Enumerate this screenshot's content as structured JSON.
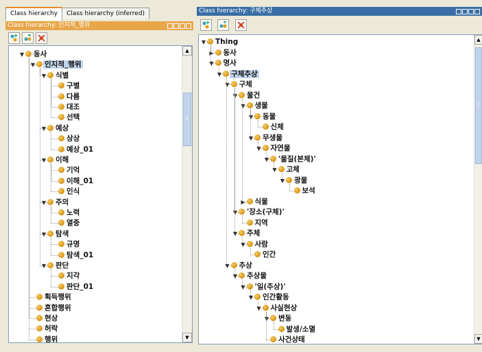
{
  "left": {
    "tabs": [
      "Class hierarchy",
      "Class hierarchy (inferred)"
    ],
    "header": "Class hierarchy: 인지적_행위",
    "toolbar": [
      "add-subclass-icon",
      "add-sibling-icon",
      "delete-class-icon"
    ],
    "tree": [
      {
        "label": "동사",
        "depth": 0,
        "expander": "open"
      },
      {
        "label": "인지적_행위",
        "depth": 1,
        "expander": "open",
        "selected": true
      },
      {
        "label": "식별",
        "depth": 2,
        "expander": "open"
      },
      {
        "label": "구별",
        "depth": 3
      },
      {
        "label": "다름",
        "depth": 3
      },
      {
        "label": "대조",
        "depth": 3
      },
      {
        "label": "선택",
        "depth": 3
      },
      {
        "label": "예상",
        "depth": 2,
        "expander": "open"
      },
      {
        "label": "상상",
        "depth": 3
      },
      {
        "label": "예상_01",
        "depth": 3
      },
      {
        "label": "이해",
        "depth": 2,
        "expander": "open"
      },
      {
        "label": "기억",
        "depth": 3
      },
      {
        "label": "이해_01",
        "depth": 3
      },
      {
        "label": "인식",
        "depth": 3
      },
      {
        "label": "주의",
        "depth": 2,
        "expander": "open"
      },
      {
        "label": "노력",
        "depth": 3
      },
      {
        "label": "열중",
        "depth": 3
      },
      {
        "label": "탐색",
        "depth": 2,
        "expander": "open"
      },
      {
        "label": "규명",
        "depth": 3
      },
      {
        "label": "탐색_01",
        "depth": 3
      },
      {
        "label": "판단",
        "depth": 2,
        "expander": "open"
      },
      {
        "label": "지각",
        "depth": 3
      },
      {
        "label": "판단_01",
        "depth": 3
      },
      {
        "label": "획득행위",
        "depth": 1
      },
      {
        "label": "혼합행위",
        "depth": 1
      },
      {
        "label": "현상",
        "depth": 1
      },
      {
        "label": "허락",
        "depth": 1
      },
      {
        "label": "행위",
        "depth": 1
      }
    ]
  },
  "right": {
    "header": "Class hierarchy: 구체추상",
    "toolbar": [
      "add-subclass-icon",
      "add-sibling-icon",
      "delete-class-icon"
    ],
    "tree": [
      {
        "label": "Thing",
        "depth": 0,
        "expander": "open"
      },
      {
        "label": "동사",
        "depth": 1,
        "expander": "closed"
      },
      {
        "label": "명사",
        "depth": 1,
        "expander": "open"
      },
      {
        "label": "구체추상",
        "depth": 2,
        "expander": "open",
        "selected": true
      },
      {
        "label": "구체",
        "depth": 3,
        "expander": "open"
      },
      {
        "label": "물건",
        "depth": 4,
        "expander": "open"
      },
      {
        "label": "생물",
        "depth": 5,
        "expander": "open"
      },
      {
        "label": "동물",
        "depth": 6,
        "expander": "open"
      },
      {
        "label": "신체",
        "depth": 7
      },
      {
        "label": "무생물",
        "depth": 6,
        "expander": "open"
      },
      {
        "label": "자연물",
        "depth": 7,
        "expander": "open"
      },
      {
        "label": "'물질(본체)'",
        "depth": 8,
        "expander": "open"
      },
      {
        "label": "고체",
        "depth": 9,
        "expander": "open"
      },
      {
        "label": "광물",
        "depth": 10,
        "expander": "open"
      },
      {
        "label": "보석",
        "depth": 11
      },
      {
        "label": "식물",
        "depth": 5,
        "expander": "closed"
      },
      {
        "label": "'장소(구체)'",
        "depth": 4,
        "expander": "open"
      },
      {
        "label": "지역",
        "depth": 5
      },
      {
        "label": "주체",
        "depth": 4,
        "expander": "open"
      },
      {
        "label": "사람",
        "depth": 5,
        "expander": "open"
      },
      {
        "label": "인간",
        "depth": 6
      },
      {
        "label": "추상",
        "depth": 3,
        "expander": "open"
      },
      {
        "label": "추상물",
        "depth": 4,
        "expander": "open"
      },
      {
        "label": "'일(추상)'",
        "depth": 5,
        "expander": "open"
      },
      {
        "label": "인간활동",
        "depth": 6,
        "expander": "open"
      },
      {
        "label": "사실현상",
        "depth": 7,
        "expander": "open"
      },
      {
        "label": "변동",
        "depth": 8,
        "expander": "open"
      },
      {
        "label": "발생/소멸",
        "depth": 9
      },
      {
        "label": "사건상태",
        "depth": 8
      }
    ]
  },
  "colors": {
    "header": "#3a6ea5",
    "accent_tab": "#e68b2c",
    "selection": "#c2d4ea",
    "bullet": "#e0a020"
  }
}
